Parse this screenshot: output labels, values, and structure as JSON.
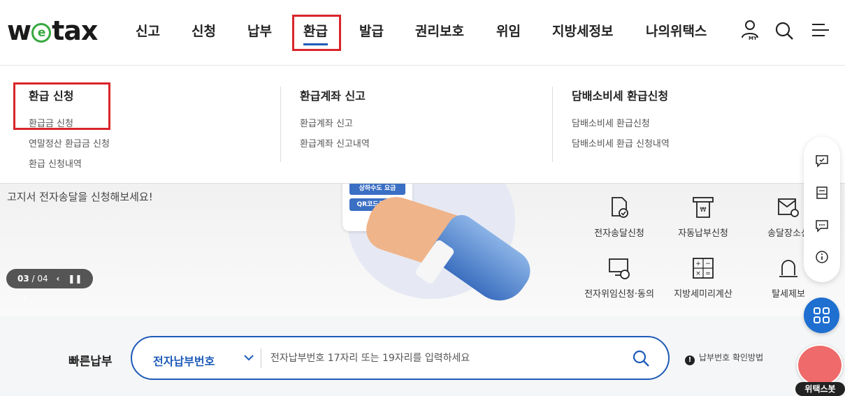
{
  "logo": {
    "pre": "w",
    "e": "e",
    "post": "tax"
  },
  "nav": {
    "items": [
      {
        "label": "신고"
      },
      {
        "label": "신청"
      },
      {
        "label": "납부"
      },
      {
        "label": "환급"
      },
      {
        "label": "발급"
      },
      {
        "label": "권리보호"
      },
      {
        "label": "위임"
      },
      {
        "label": "지방세정보"
      },
      {
        "label": "나의위택스"
      }
    ],
    "my_label": "MY"
  },
  "dropdown": {
    "columns": [
      {
        "title": "환급 신청",
        "links": [
          "환급금 신청",
          "연말정산 환급금 신청",
          "환급 신청내역"
        ]
      },
      {
        "title": "환급계좌 신고",
        "links": [
          "환급계좌 신고",
          "환급계좌 신고내역"
        ]
      },
      {
        "title": "담배소비세 환급신청",
        "links": [
          "담배소비세 환급신청",
          "담배소비세 환급 신청내역"
        ]
      }
    ]
  },
  "banner": {
    "text": "고지서 전자송달을 신청해보세요!",
    "phone_buttons": [
      "상하수도 요금",
      "QR코드로 납부"
    ],
    "pager": {
      "current": "03",
      "total": "/ 04"
    },
    "quick_links": [
      {
        "label": "전자송달신청",
        "icon": "document-check-icon"
      },
      {
        "label": "자동납부신청",
        "icon": "bill-machine-icon"
      },
      {
        "label": "송달장소신",
        "icon": "mail-location-icon"
      },
      {
        "label": "전자위임신청·동의",
        "icon": "monitor-lock-icon"
      },
      {
        "label": "지방세미리계산",
        "icon": "calculator-icon"
      },
      {
        "label": "탈세제보",
        "icon": "alarm-bell-icon"
      }
    ]
  },
  "quickpay": {
    "title": "빠른납부",
    "select_value": "전자납부번호",
    "placeholder": "전자납부번호 17자리 또는 19자리를 입력하세요",
    "help": "납부번호 확인방법",
    "help_icon": "!"
  },
  "chatbot": {
    "label": "위택스봇"
  },
  "colors": {
    "accent": "#1e5bb8",
    "highlight": "#d9252a",
    "fab": "#1e6fd0"
  }
}
